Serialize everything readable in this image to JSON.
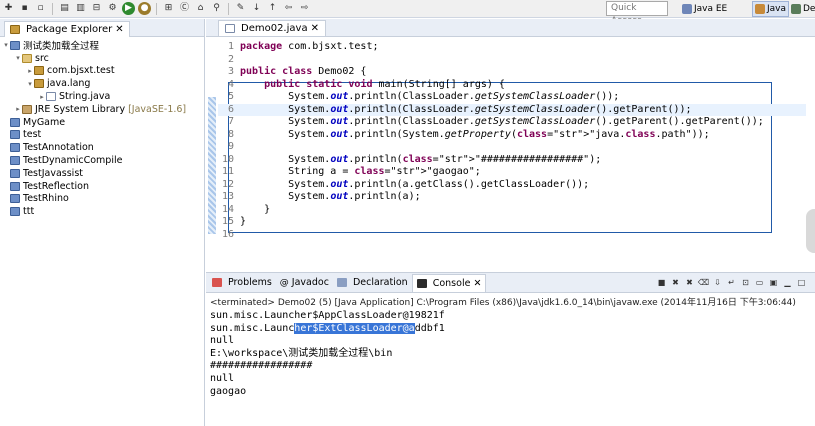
{
  "toolbar": {
    "quick_access": "Quick Access",
    "perspectives": [
      {
        "label": "Java EE"
      },
      {
        "label": "Java"
      },
      {
        "label": "Deb"
      }
    ]
  },
  "package_explorer": {
    "title": "Package Explorer",
    "tree": [
      {
        "depth": 0,
        "twisty": "▾",
        "icon": "project-icon",
        "label": "测试类加载全过程"
      },
      {
        "depth": 1,
        "twisty": "▾",
        "icon": "source-folder-icon",
        "label": "src"
      },
      {
        "depth": 2,
        "twisty": "▸",
        "icon": "package-icon",
        "label": "com.bjsxt.test"
      },
      {
        "depth": 2,
        "twisty": "▾",
        "icon": "package-icon",
        "label": "java.lang"
      },
      {
        "depth": 3,
        "twisty": "▸",
        "icon": "java-file-icon",
        "label": "String.java"
      },
      {
        "depth": 1,
        "twisty": "▸",
        "icon": "library-icon",
        "label": "JRE System Library",
        "suffix": "[JavaSE-1.6]"
      },
      {
        "depth": 0,
        "twisty": "",
        "icon": "project-icon",
        "label": "MyGame"
      },
      {
        "depth": 0,
        "twisty": "",
        "icon": "project-icon",
        "label": "test"
      },
      {
        "depth": 0,
        "twisty": "",
        "icon": "project-icon",
        "label": "TestAnnotation"
      },
      {
        "depth": 0,
        "twisty": "",
        "icon": "project-icon",
        "label": "TestDynamicCompile"
      },
      {
        "depth": 0,
        "twisty": "",
        "icon": "project-icon",
        "label": "TestJavassist"
      },
      {
        "depth": 0,
        "twisty": "",
        "icon": "project-icon",
        "label": "TestReflection"
      },
      {
        "depth": 0,
        "twisty": "",
        "icon": "project-icon",
        "label": "TestRhino"
      },
      {
        "depth": 0,
        "twisty": "",
        "icon": "project-icon",
        "label": "ttt"
      }
    ]
  },
  "editor": {
    "tab_label": "Demo02.java",
    "line_numbers": [
      "1",
      "2",
      "3",
      "4",
      "5",
      "6",
      "7",
      "8",
      "9",
      "10",
      "11",
      "12",
      "13",
      "14",
      "15",
      "16"
    ],
    "lines": [
      "package com.bjsxt.test;",
      "",
      "public class Demo02 {",
      "    public static void main(String[] args) {",
      "        System.out.println(ClassLoader.getSystemClassLoader());",
      "        System.out.println(ClassLoader.getSystemClassLoader().getParent());",
      "        System.out.println(ClassLoader.getSystemClassLoader().getParent().getParent());",
      "        System.out.println(System.getProperty(\"java.class.path\"));",
      "",
      "        System.out.println(\"#################\");",
      "        String a = \"gaogao\";",
      "        System.out.println(a.getClass().getClassLoader());",
      "        System.out.println(a);",
      "    }",
      "}",
      ""
    ]
  },
  "bottom": {
    "tabs": [
      "Problems",
      "Javadoc",
      "Declaration",
      "Console"
    ],
    "terminated": "<terminated> Demo02 (5) [Java Application] C:\\Program Files (x86)\\Java\\jdk1.6.0_14\\bin\\javaw.exe (2014年11月16日 下午3:06:44)",
    "output": [
      "sun.misc.Launcher$AppClassLoader@19821f",
      "sun.misc.Launcher$ExtClassLoader@addbf1",
      "null",
      "E:\\workspace\\测试类加载全过程\\bin",
      "#################",
      "null",
      "gaogao"
    ]
  }
}
